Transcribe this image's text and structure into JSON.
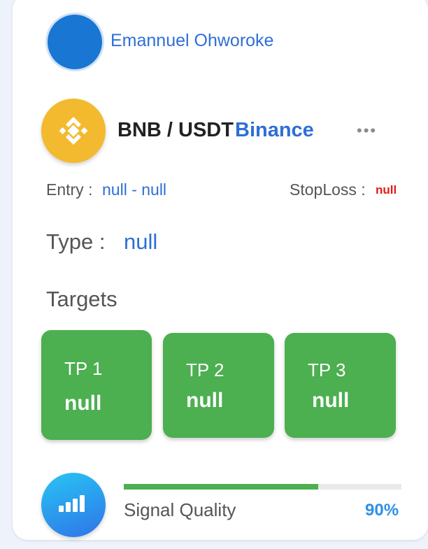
{
  "user": {
    "name": "Emannuel Ohworoke"
  },
  "signal": {
    "pair": "BNB / USDT",
    "exchange": "Binance",
    "entry_label": "Entry :",
    "entry_value": "null - null",
    "stoploss_label": "StopLoss :",
    "stoploss_value": "null",
    "type_label": "Type :",
    "type_value": "null"
  },
  "targets": {
    "heading": "Targets",
    "items": [
      {
        "label": "TP 1",
        "value": "null"
      },
      {
        "label": "TP 2",
        "value": "null"
      },
      {
        "label": "TP 3",
        "value": "null"
      }
    ]
  },
  "quality": {
    "label": "Signal Quality",
    "percent_text": "90%",
    "level": 0.7
  },
  "icons": {
    "coin": "binance-coin-icon",
    "more": "more-options-icon",
    "quality": "signal-bars-icon"
  },
  "colors": {
    "accent_blue": "#2f6fd6",
    "tp_green": "#4caf50",
    "stoploss_red": "#e31b1b",
    "binance_yellow": "#f3ba2f"
  }
}
